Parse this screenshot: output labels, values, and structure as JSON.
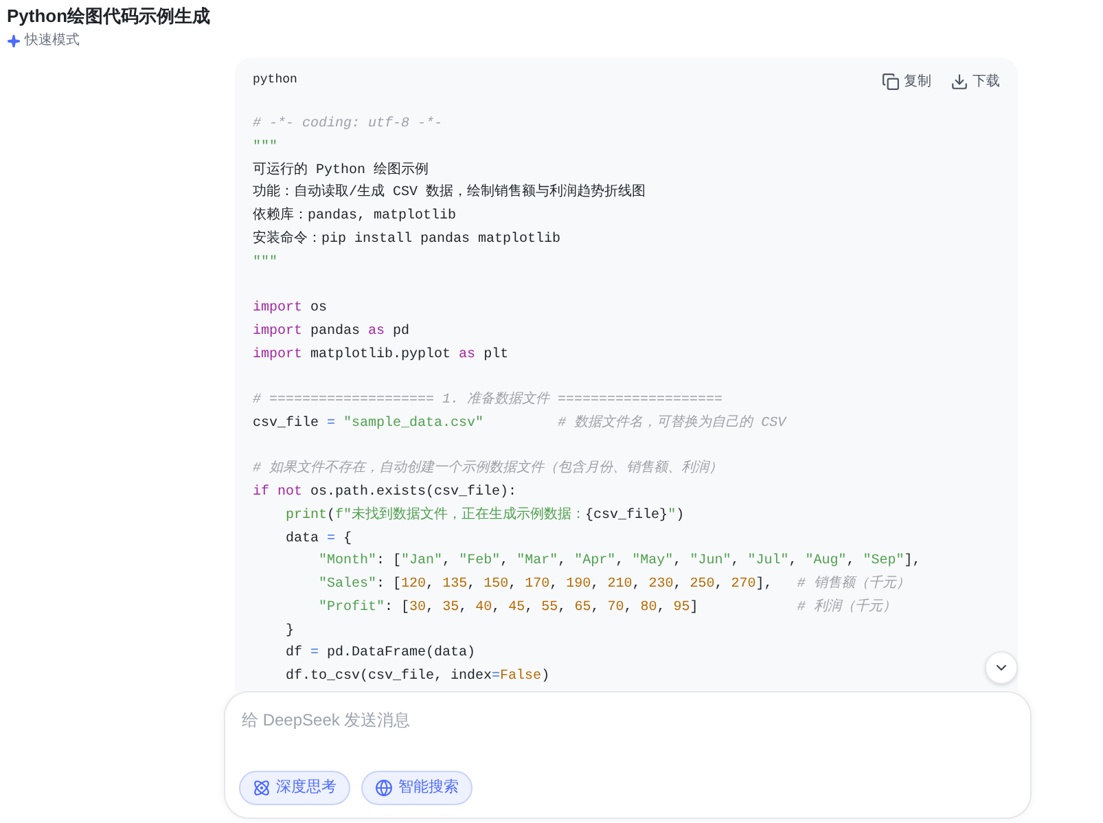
{
  "header": {
    "title": "Python绘图代码示例生成",
    "mode": "快速模式"
  },
  "code_block": {
    "language": "python",
    "actions": [
      {
        "kind": "copy",
        "label": "复制"
      },
      {
        "kind": "download",
        "label": "下载"
      }
    ],
    "lines": [
      {
        "kind": "code",
        "tokens": [
          {
            "kind": "comment",
            "text": "# -*- coding: utf-8 -*-"
          }
        ]
      },
      {
        "kind": "code",
        "tokens": [
          {
            "kind": "string",
            "text": "\"\"\""
          }
        ]
      },
      {
        "kind": "code",
        "tokens": [
          {
            "kind": "plain",
            "text": "可运行的 Python 绘图示例"
          }
        ]
      },
      {
        "kind": "code",
        "tokens": [
          {
            "kind": "plain",
            "text": "功能：自动读取/生成 CSV 数据，绘制销售额与利润趋势折线图"
          }
        ]
      },
      {
        "kind": "code",
        "tokens": [
          {
            "kind": "plain",
            "text": "依赖库：pandas, matplotlib"
          }
        ]
      },
      {
        "kind": "code",
        "tokens": [
          {
            "kind": "plain",
            "text": "安装命令：pip install pandas matplotlib"
          }
        ]
      },
      {
        "kind": "code",
        "tokens": [
          {
            "kind": "string",
            "text": "\"\"\""
          }
        ]
      },
      {
        "kind": "blank"
      },
      {
        "kind": "code",
        "tokens": [
          {
            "kind": "keyword",
            "text": "import"
          },
          {
            "kind": "plain",
            "text": " os"
          }
        ]
      },
      {
        "kind": "code",
        "tokens": [
          {
            "kind": "keyword",
            "text": "import"
          },
          {
            "kind": "plain",
            "text": " pandas "
          },
          {
            "kind": "keyword",
            "text": "as"
          },
          {
            "kind": "plain",
            "text": " pd"
          }
        ]
      },
      {
        "kind": "code",
        "tokens": [
          {
            "kind": "keyword",
            "text": "import"
          },
          {
            "kind": "plain",
            "text": " matplotlib.pyplot "
          },
          {
            "kind": "keyword",
            "text": "as"
          },
          {
            "kind": "plain",
            "text": " plt"
          }
        ]
      },
      {
        "kind": "blank"
      },
      {
        "kind": "code",
        "tokens": [
          {
            "kind": "comment",
            "text": "# ==================== 1. 准备数据文件 ===================="
          }
        ]
      },
      {
        "kind": "code",
        "tokens": [
          {
            "kind": "plain",
            "text": "csv_file "
          },
          {
            "kind": "operator",
            "text": "="
          },
          {
            "kind": "string",
            "text": " \"sample_data.csv\""
          },
          {
            "kind": "comment",
            "text": "         # 数据文件名，可替换为自己的 CSV"
          }
        ]
      },
      {
        "kind": "blank"
      },
      {
        "kind": "code",
        "tokens": [
          {
            "kind": "comment",
            "text": "# 如果文件不存在，自动创建一个示例数据文件（包含月份、销售额、利润）"
          }
        ]
      },
      {
        "kind": "code",
        "tokens": [
          {
            "kind": "keyword",
            "text": "if"
          },
          {
            "kind": "keyword",
            "text": " not"
          },
          {
            "kind": "plain",
            "text": " os.path.exists(csv_file):"
          }
        ]
      },
      {
        "kind": "code",
        "tokens": [
          {
            "kind": "builtin",
            "text": "    print"
          },
          {
            "kind": "plain",
            "text": "("
          },
          {
            "kind": "string",
            "text": "f\"未找到数据文件，正在生成示例数据："
          },
          {
            "kind": "plain",
            "text": "{csv_file}"
          },
          {
            "kind": "string",
            "text": "\""
          },
          {
            "kind": "plain",
            "text": ")"
          }
        ]
      },
      {
        "kind": "code",
        "tokens": [
          {
            "kind": "plain",
            "text": "    data "
          },
          {
            "kind": "operator",
            "text": "="
          },
          {
            "kind": "plain",
            "text": " {"
          }
        ]
      },
      {
        "kind": "code",
        "tokens": [
          {
            "kind": "string",
            "text": "        \"Month\""
          },
          {
            "kind": "plain",
            "text": ": ["
          },
          {
            "kind": "string",
            "text": "\"Jan\""
          },
          {
            "kind": "plain",
            "text": ", "
          },
          {
            "kind": "string",
            "text": "\"Feb\""
          },
          {
            "kind": "plain",
            "text": ", "
          },
          {
            "kind": "string",
            "text": "\"Mar\""
          },
          {
            "kind": "plain",
            "text": ", "
          },
          {
            "kind": "string",
            "text": "\"Apr\""
          },
          {
            "kind": "plain",
            "text": ", "
          },
          {
            "kind": "string",
            "text": "\"May\""
          },
          {
            "kind": "plain",
            "text": ", "
          },
          {
            "kind": "string",
            "text": "\"Jun\""
          },
          {
            "kind": "plain",
            "text": ", "
          },
          {
            "kind": "string",
            "text": "\"Jul\""
          },
          {
            "kind": "plain",
            "text": ", "
          },
          {
            "kind": "string",
            "text": "\"Aug\""
          },
          {
            "kind": "plain",
            "text": ", "
          },
          {
            "kind": "string",
            "text": "\"Sep\""
          },
          {
            "kind": "plain",
            "text": "],"
          }
        ]
      },
      {
        "kind": "code",
        "tokens": [
          {
            "kind": "string",
            "text": "        \"Sales\""
          },
          {
            "kind": "plain",
            "text": ": ["
          },
          {
            "kind": "number",
            "text": "120"
          },
          {
            "kind": "plain",
            "text": ", "
          },
          {
            "kind": "number",
            "text": "135"
          },
          {
            "kind": "plain",
            "text": ", "
          },
          {
            "kind": "number",
            "text": "150"
          },
          {
            "kind": "plain",
            "text": ", "
          },
          {
            "kind": "number",
            "text": "170"
          },
          {
            "kind": "plain",
            "text": ", "
          },
          {
            "kind": "number",
            "text": "190"
          },
          {
            "kind": "plain",
            "text": ", "
          },
          {
            "kind": "number",
            "text": "210"
          },
          {
            "kind": "plain",
            "text": ", "
          },
          {
            "kind": "number",
            "text": "230"
          },
          {
            "kind": "plain",
            "text": ", "
          },
          {
            "kind": "number",
            "text": "250"
          },
          {
            "kind": "plain",
            "text": ", "
          },
          {
            "kind": "number",
            "text": "270"
          },
          {
            "kind": "plain",
            "text": "],   "
          },
          {
            "kind": "comment",
            "text": "# 销售额（千元）"
          }
        ]
      },
      {
        "kind": "code",
        "tokens": [
          {
            "kind": "string",
            "text": "        \"Profit\""
          },
          {
            "kind": "plain",
            "text": ": ["
          },
          {
            "kind": "number",
            "text": "30"
          },
          {
            "kind": "plain",
            "text": ", "
          },
          {
            "kind": "number",
            "text": "35"
          },
          {
            "kind": "plain",
            "text": ", "
          },
          {
            "kind": "number",
            "text": "40"
          },
          {
            "kind": "plain",
            "text": ", "
          },
          {
            "kind": "number",
            "text": "45"
          },
          {
            "kind": "plain",
            "text": ", "
          },
          {
            "kind": "number",
            "text": "55"
          },
          {
            "kind": "plain",
            "text": ", "
          },
          {
            "kind": "number",
            "text": "65"
          },
          {
            "kind": "plain",
            "text": ", "
          },
          {
            "kind": "number",
            "text": "70"
          },
          {
            "kind": "plain",
            "text": ", "
          },
          {
            "kind": "number",
            "text": "80"
          },
          {
            "kind": "plain",
            "text": ", "
          },
          {
            "kind": "number",
            "text": "95"
          },
          {
            "kind": "plain",
            "text": "]            "
          },
          {
            "kind": "comment",
            "text": "# 利润（千元）"
          }
        ]
      },
      {
        "kind": "code",
        "tokens": [
          {
            "kind": "plain",
            "text": "    }"
          }
        ]
      },
      {
        "kind": "code",
        "tokens": [
          {
            "kind": "plain",
            "text": "    df "
          },
          {
            "kind": "operator",
            "text": "="
          },
          {
            "kind": "plain",
            "text": " pd.DataFrame(data)"
          }
        ]
      },
      {
        "kind": "code",
        "tokens": [
          {
            "kind": "plain",
            "text": "    df.to_csv(csv_file, index"
          },
          {
            "kind": "operator",
            "text": "="
          },
          {
            "kind": "number",
            "text": "False"
          },
          {
            "kind": "plain",
            "text": ")"
          }
        ]
      }
    ]
  },
  "composer": {
    "placeholder": "给 DeepSeek 发送消息",
    "toggles": [
      {
        "kind": "deep_think",
        "label": "深度思考",
        "selected": true
      },
      {
        "kind": "search",
        "label": "智能搜索",
        "selected": true
      }
    ]
  }
}
